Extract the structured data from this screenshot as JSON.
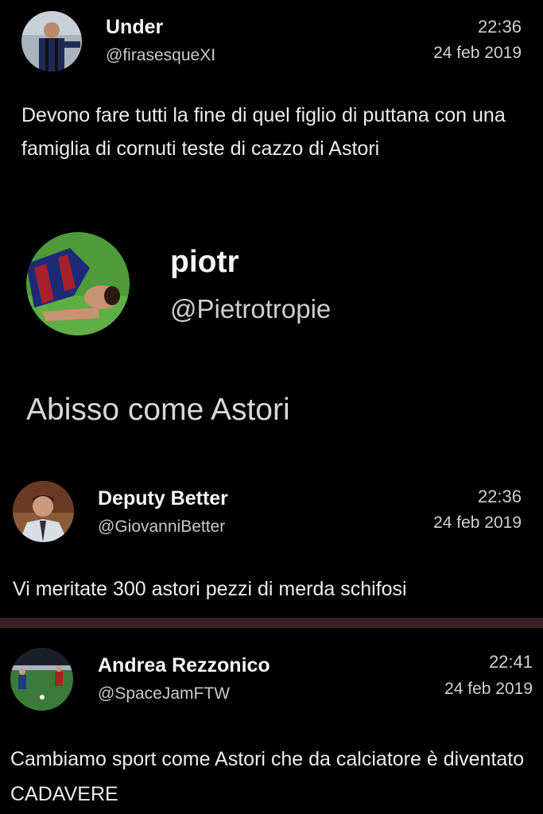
{
  "tweets": [
    {
      "name": "Under",
      "handle": "@firasesqueXI",
      "time": "22:36",
      "date": "24 feb 2019",
      "text": "Devono fare tutti la fine di quel figlio di puttana con una famiglia di cornuti teste di cazzo di Astori"
    },
    {
      "name": "piotr",
      "handle": "@Pietrotropie",
      "text": "Abisso come Astori"
    },
    {
      "name": "Deputy Better",
      "handle": "@GiovanniBetter",
      "time": "22:36",
      "date": "24 feb 2019",
      "text": "Vi meritate 300 astori pezzi di merda schifosi"
    },
    {
      "name": "Andrea Rezzonico",
      "handle": "@SpaceJamFTW",
      "time": "22:41",
      "date": "24 feb 2019",
      "text": "Cambiamo sport come Astori che da calciatore è diventato CADAVERE"
    }
  ],
  "colors": {
    "background": "#000000",
    "divider": "#3a2022",
    "name": "#f4f4f4",
    "handle": "#c9c9c9",
    "text": "#ececec"
  }
}
